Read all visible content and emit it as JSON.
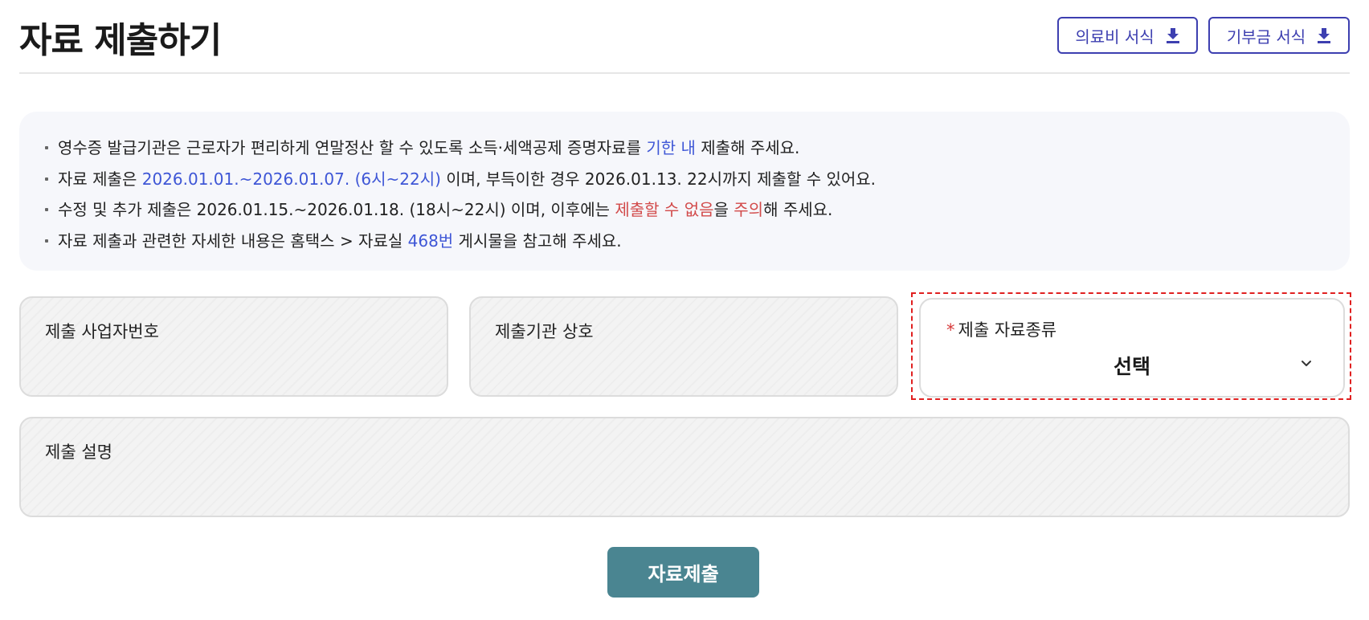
{
  "header": {
    "title": "자료 제출하기",
    "buttons": [
      {
        "label": "의료비 서식",
        "icon": "download-icon"
      },
      {
        "label": "기부금 서식",
        "icon": "download-icon"
      }
    ]
  },
  "notice": {
    "line1": {
      "a": "영수증 발급기관은 근로자가 편리하게 연말정산 할 수 있도록 소득·세액공제 증명자료를 ",
      "b": "기한 내",
      "c": " 제출해 주세요."
    },
    "line2": {
      "a": "자료 제출은 ",
      "b": "2026.01.01.~2026.01.07. (6시~22시)",
      "c": " 이며, 부득이한 경우 2026.01.13. 22시까지 제출할 수 있어요."
    },
    "line3": {
      "a": "수정 및 추가 제출은 2026.01.15.~2026.01.18. (18시~22시) 이며, 이후에는 ",
      "b": "제출할 수 없음",
      "c": "을 ",
      "d": "주의",
      "e": "해 주세요."
    },
    "line4": {
      "a": "자료 제출과 관련한 자세한 내용은 홈택스 > 자료실 ",
      "b": "468번",
      "c": " 게시물을 참고해 주세요."
    }
  },
  "form": {
    "business_no_label": "제출 사업자번호",
    "org_name_label": "제출기관 상호",
    "doc_type": {
      "required_mark": "*",
      "label": "제출 자료종류",
      "value": "선택"
    },
    "description_label": "제출 설명",
    "submit_label": "자료제출"
  },
  "colors": {
    "accent": "#3d3fb0",
    "link_blue": "#3e56d6",
    "warning_red": "#d24a4a",
    "submit": "#4a8591",
    "highlight_dashed": "#e02020"
  }
}
